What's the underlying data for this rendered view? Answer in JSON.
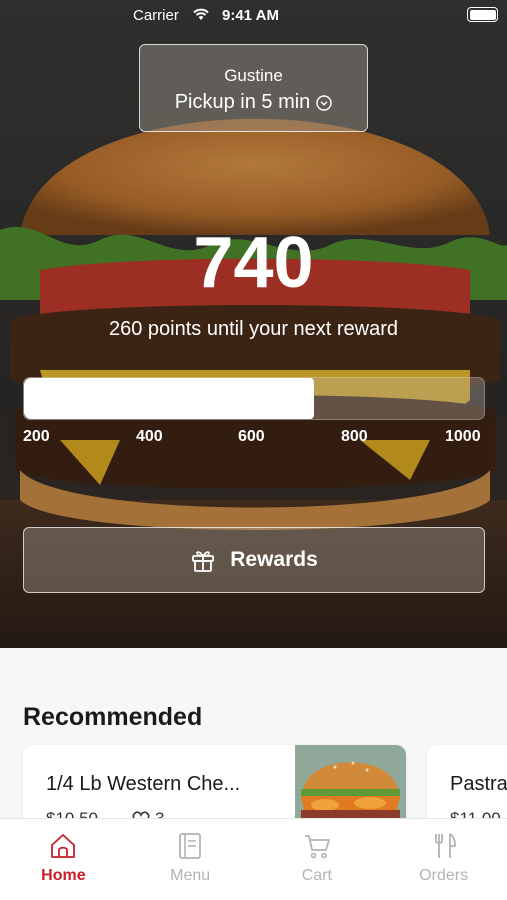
{
  "status_bar": {
    "carrier": "Carrier",
    "time": "9:41 AM"
  },
  "location": {
    "store": "Gustine",
    "pickup": "Pickup in 5 min"
  },
  "points": {
    "value": "740",
    "caption": "260 points until your next reward",
    "progress_fraction": 0.63,
    "ticks": [
      "200",
      "400",
      "600",
      "800",
      "1000"
    ]
  },
  "rewards_button": {
    "label": "Rewards",
    "icon": "gift-icon"
  },
  "recommended": {
    "title": "Recommended",
    "items": [
      {
        "name": "1/4 Lb Western Che...",
        "price": "$10.50",
        "likes": "3",
        "icon": "heart-icon"
      },
      {
        "name": "Pastra",
        "price": "$11.00"
      }
    ]
  },
  "tabs": [
    {
      "label": "Home",
      "icon": "home-icon",
      "active": true
    },
    {
      "label": "Menu",
      "icon": "menu-book-icon",
      "active": false
    },
    {
      "label": "Cart",
      "icon": "cart-icon",
      "active": false
    },
    {
      "label": "Orders",
      "icon": "fork-knife-icon",
      "active": false
    }
  ],
  "colors": {
    "accent": "#c8202a",
    "inactive": "#b3b3b3"
  }
}
